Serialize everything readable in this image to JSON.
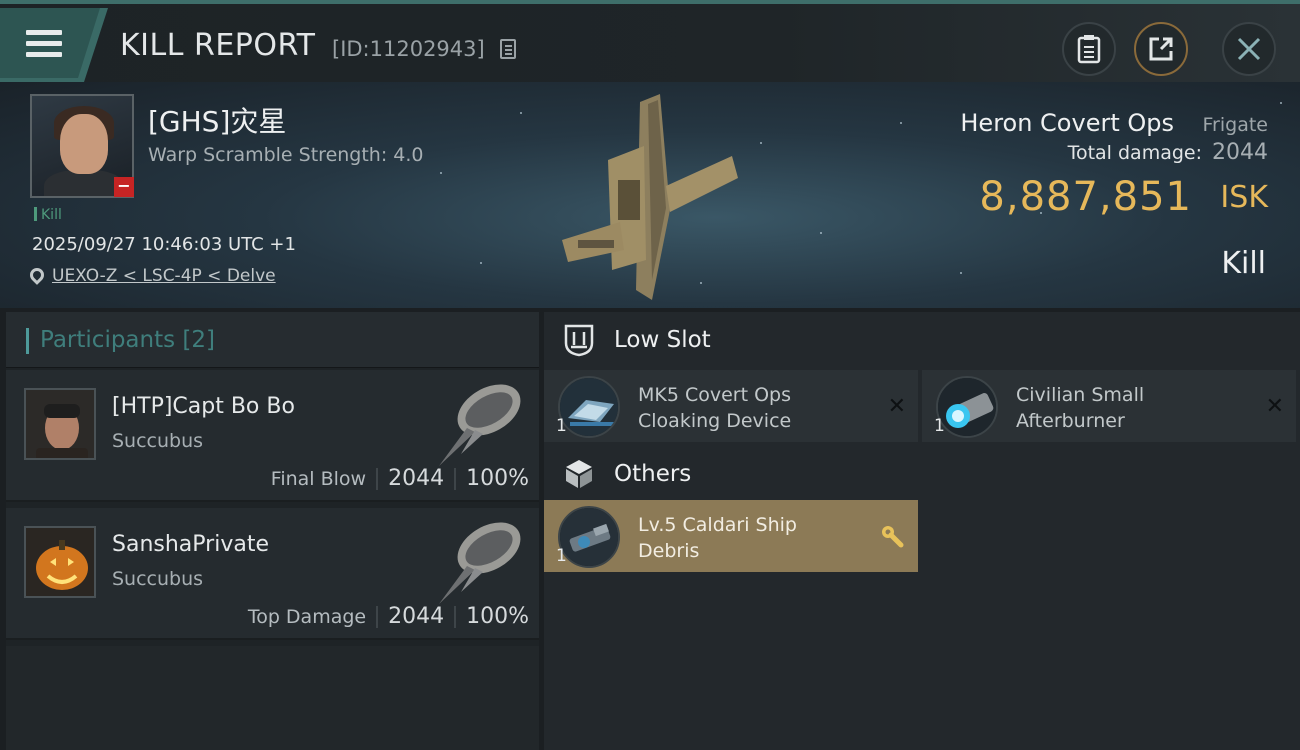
{
  "header": {
    "title": "KILL REPORT",
    "report_id": "[ID:11202943]",
    "icons": [
      "menu-icon",
      "copy-icon",
      "clipboard-icon",
      "share-icon",
      "close-icon"
    ]
  },
  "victim": {
    "name": "[GHS]灾星",
    "warp_scramble": "Warp Scramble Strength: 4.0",
    "tag": "Kill",
    "timestamp": "2025/09/27 10:46:03 UTC +1",
    "location": "UEXO-Z < LSC-4P < Delve",
    "ship_name": "Heron Covert Ops",
    "ship_class": "Frigate",
    "total_damage_label": "Total damage:",
    "total_damage": "2044",
    "isk_value": "8,887,851",
    "isk_unit": "ISK",
    "result": "Kill"
  },
  "participants": {
    "title": "Participants [2]",
    "rows": [
      {
        "name": "[HTP]Capt Bo Bo",
        "ship": "Succubus",
        "role": "Final Blow",
        "damage": "2044",
        "percent": "100%"
      },
      {
        "name": "SanshaPrivate",
        "ship": "Succubus",
        "role": "Top Damage",
        "damage": "2044",
        "percent": "100%"
      }
    ]
  },
  "slots": {
    "low_slot": {
      "label": "Low Slot",
      "items": [
        {
          "name_line1": "MK5 Covert Ops",
          "name_line2": "Cloaking Device",
          "qty": "1"
        },
        {
          "name_line1": "Civilian Small",
          "name_line2": "Afterburner",
          "qty": "1"
        }
      ]
    },
    "others": {
      "label": "Others",
      "items": [
        {
          "name_line1": "Lv.5 Caldari Ship",
          "name_line2": "Debris",
          "qty": "1"
        }
      ]
    }
  },
  "colors": {
    "accent_teal": "#4e9a9a",
    "isk_gold": "#e6b85a",
    "destroyed_badge": "#c62424",
    "highlight_item": "#8c7a56"
  }
}
